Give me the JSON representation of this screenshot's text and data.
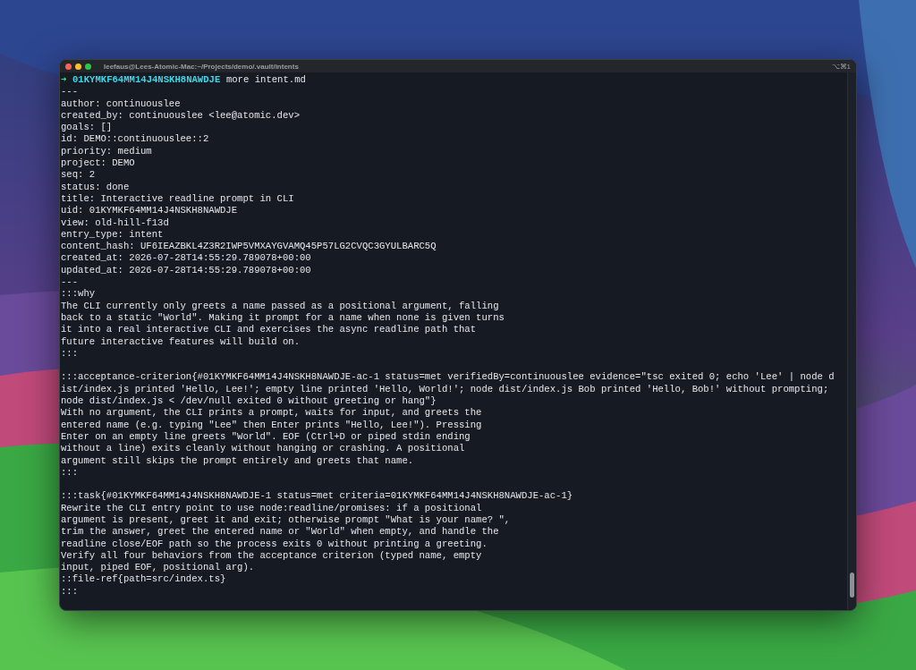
{
  "window": {
    "title": "leefaus@Lees-Atomic-Mac:~/Projects/demo/.vault/intents",
    "shortcut": "⌥⌘1"
  },
  "terminal": {
    "lines": [
      {
        "kind": "prompt",
        "arrow": "➜",
        "directory": "01KYMKF64MM14J4NSKH8NAWDJE",
        "command": "more intent.md"
      },
      {
        "kind": "text",
        "text": "---"
      },
      {
        "kind": "text",
        "text": "author: continuouslee"
      },
      {
        "kind": "text",
        "text": "created_by: continuouslee <lee@atomic.dev>"
      },
      {
        "kind": "text",
        "text": "goals: []"
      },
      {
        "kind": "text",
        "text": "id: DEMO::continuouslee::2"
      },
      {
        "kind": "text",
        "text": "priority: medium"
      },
      {
        "kind": "text",
        "text": "project: DEMO"
      },
      {
        "kind": "text",
        "text": "seq: 2"
      },
      {
        "kind": "text",
        "text": "status: done"
      },
      {
        "kind": "text",
        "text": "title: Interactive readline prompt in CLI"
      },
      {
        "kind": "text",
        "text": "uid: 01KYMKF64MM14J4NSKH8NAWDJE"
      },
      {
        "kind": "text",
        "text": "view: old-hill-f13d"
      },
      {
        "kind": "text",
        "text": "entry_type: intent"
      },
      {
        "kind": "text",
        "text": "content_hash: UF6IEAZBKL4Z3R2IWP5VMXAYGVAMQ45P57LG2CVQC3GYULBARC5Q"
      },
      {
        "kind": "text",
        "text": "created_at: 2026-07-28T14:55:29.789078+00:00"
      },
      {
        "kind": "text",
        "text": "updated_at: 2026-07-28T14:55:29.789078+00:00"
      },
      {
        "kind": "text",
        "text": "---"
      },
      {
        "kind": "text",
        "text": ":::why"
      },
      {
        "kind": "text",
        "text": "The CLI currently only greets a name passed as a positional argument, falling"
      },
      {
        "kind": "text",
        "text": "back to a static \"World\". Making it prompt for a name when none is given turns"
      },
      {
        "kind": "text",
        "text": "it into a real interactive CLI and exercises the async readline path that"
      },
      {
        "kind": "text",
        "text": "future interactive features will build on."
      },
      {
        "kind": "text",
        "text": ":::"
      },
      {
        "kind": "blank"
      },
      {
        "kind": "text",
        "text": ":::acceptance-criterion{#01KYMKF64MM14J4NSKH8NAWDJE-ac-1 status=met verifiedBy=continuouslee evidence=\"tsc exited 0; echo 'Lee' | node d"
      },
      {
        "kind": "text",
        "text": "ist/index.js printed 'Hello, Lee!'; empty line printed 'Hello, World!'; node dist/index.js Bob printed 'Hello, Bob!' without prompting;"
      },
      {
        "kind": "text",
        "text": "node dist/index.js < /dev/null exited 0 without greeting or hang\"}"
      },
      {
        "kind": "text",
        "text": "With no argument, the CLI prints a prompt, waits for input, and greets the"
      },
      {
        "kind": "text",
        "text": "entered name (e.g. typing \"Lee\" then Enter prints \"Hello, Lee!\"). Pressing"
      },
      {
        "kind": "text",
        "text": "Enter on an empty line greets \"World\". EOF (Ctrl+D or piped stdin ending"
      },
      {
        "kind": "text",
        "text": "without a line) exits cleanly without hanging or crashing. A positional"
      },
      {
        "kind": "text",
        "text": "argument still skips the prompt entirely and greets that name."
      },
      {
        "kind": "text",
        "text": ":::"
      },
      {
        "kind": "blank"
      },
      {
        "kind": "text",
        "text": ":::task{#01KYMKF64MM14J4NSKH8NAWDJE-1 status=met criteria=01KYMKF64MM14J4NSKH8NAWDJE-ac-1}"
      },
      {
        "kind": "text",
        "text": "Rewrite the CLI entry point to use node:readline/promises: if a positional"
      },
      {
        "kind": "text",
        "text": "argument is present, greet it and exit; otherwise prompt \"What is your name? \","
      },
      {
        "kind": "text",
        "text": "trim the answer, greet the entered name or \"World\" when empty, and handle the"
      },
      {
        "kind": "text",
        "text": "readline close/EOF path so the process exits 0 without printing a greeting."
      },
      {
        "kind": "text",
        "text": "Verify all four behaviors from the acceptance criterion (typed name, empty"
      },
      {
        "kind": "text",
        "text": "input, piped EOF, positional arg)."
      },
      {
        "kind": "text",
        "text": "::file-ref{path=src/index.ts}"
      },
      {
        "kind": "text",
        "text": ":::"
      }
    ]
  }
}
